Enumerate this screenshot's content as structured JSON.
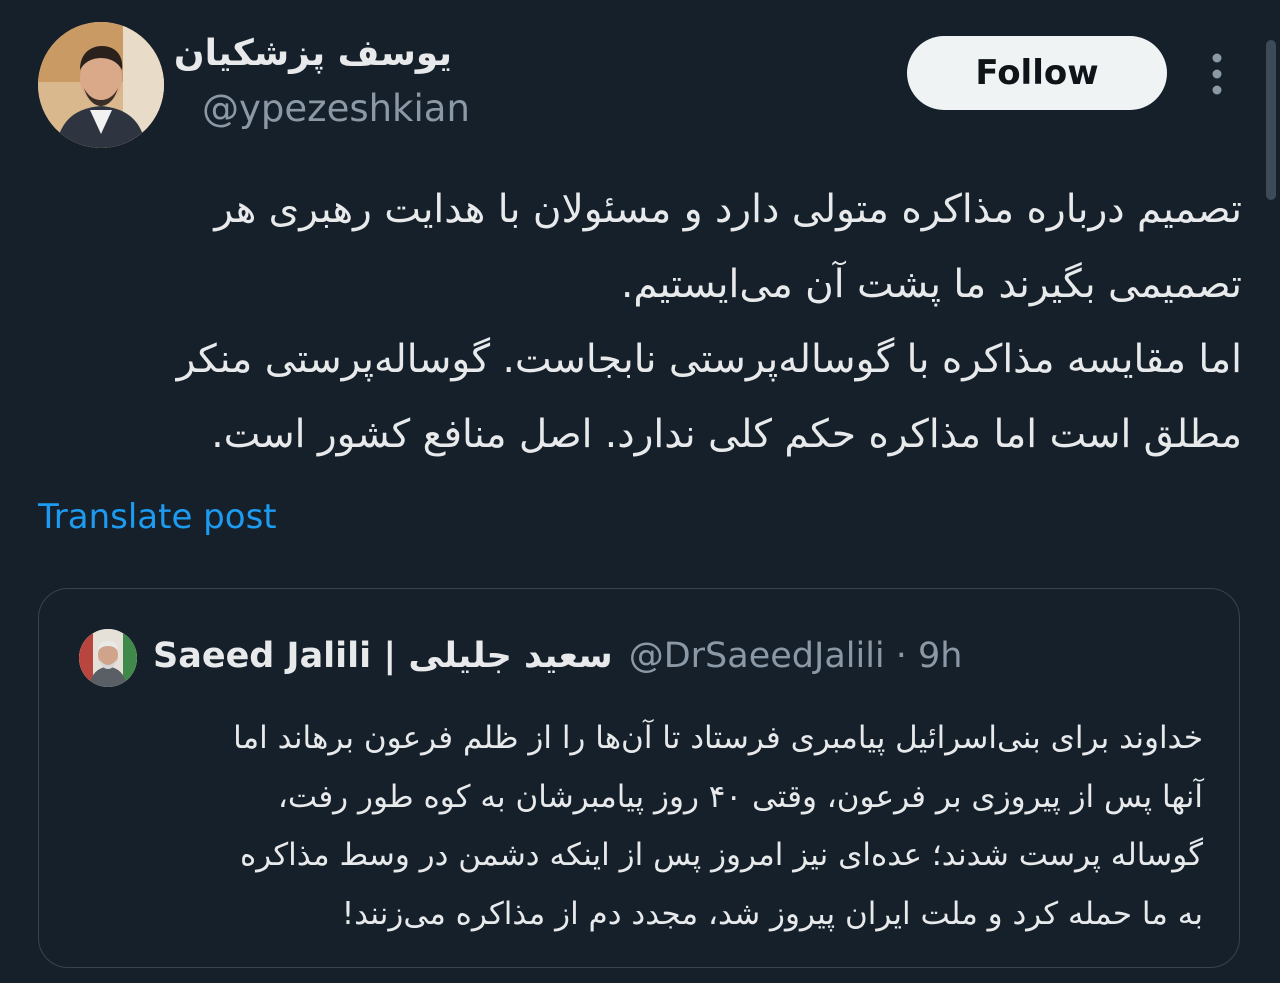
{
  "author": {
    "display_name": "یوسف پزشکیان",
    "handle": "@ypezeshkian"
  },
  "follow_button": "Follow",
  "post": {
    "lines": [
      "تصمیم درباره مذاکره متولی دارد و مسئولان با هدایت رهبری هر",
      "تصمیمی بگیرند ما پشت آن می‌ایستیم.",
      "اما مقایسه مذاکره با گوساله‌پرستی نابجاست. گوساله‌پرستی منکر",
      "مطلق است اما مذاکره حکم کلی ندارد. اصل منافع کشور است."
    ]
  },
  "translate_link": "Translate post",
  "quoted_post": {
    "display_name": "Saeed Jalili | سعید جلیلی",
    "handle_time": "@DrSaeedJalili · 9h",
    "lines": [
      "خداوند برای بنی‌اسرائیل پیامبری فرستاد تا آن‌ها را از ظلم فرعون برهاند اما",
      "آنها پس از پیروزی بر فرعون، وقتی ۴۰ روز پیامبرشان به کوه طور رفت،",
      "گوساله پرست شدند؛ عده‌ای نیز امروز پس از اینکه دشمن در وسط مذاکره",
      "به ما حمله کرد و ملت ایران پیروز شد، مجدد دم از مذاکره می‌زنند!"
    ]
  },
  "icons": {
    "more": "more-vertical-icon",
    "avatar": "avatar",
    "quoted_avatar": "quoted-avatar"
  },
  "colors": {
    "background": "#15202b",
    "text": "#e7e9ea",
    "secondary": "#8b98a5",
    "link": "#1d9bf0",
    "button_bg": "#eff3f4",
    "border": "#38444d"
  }
}
